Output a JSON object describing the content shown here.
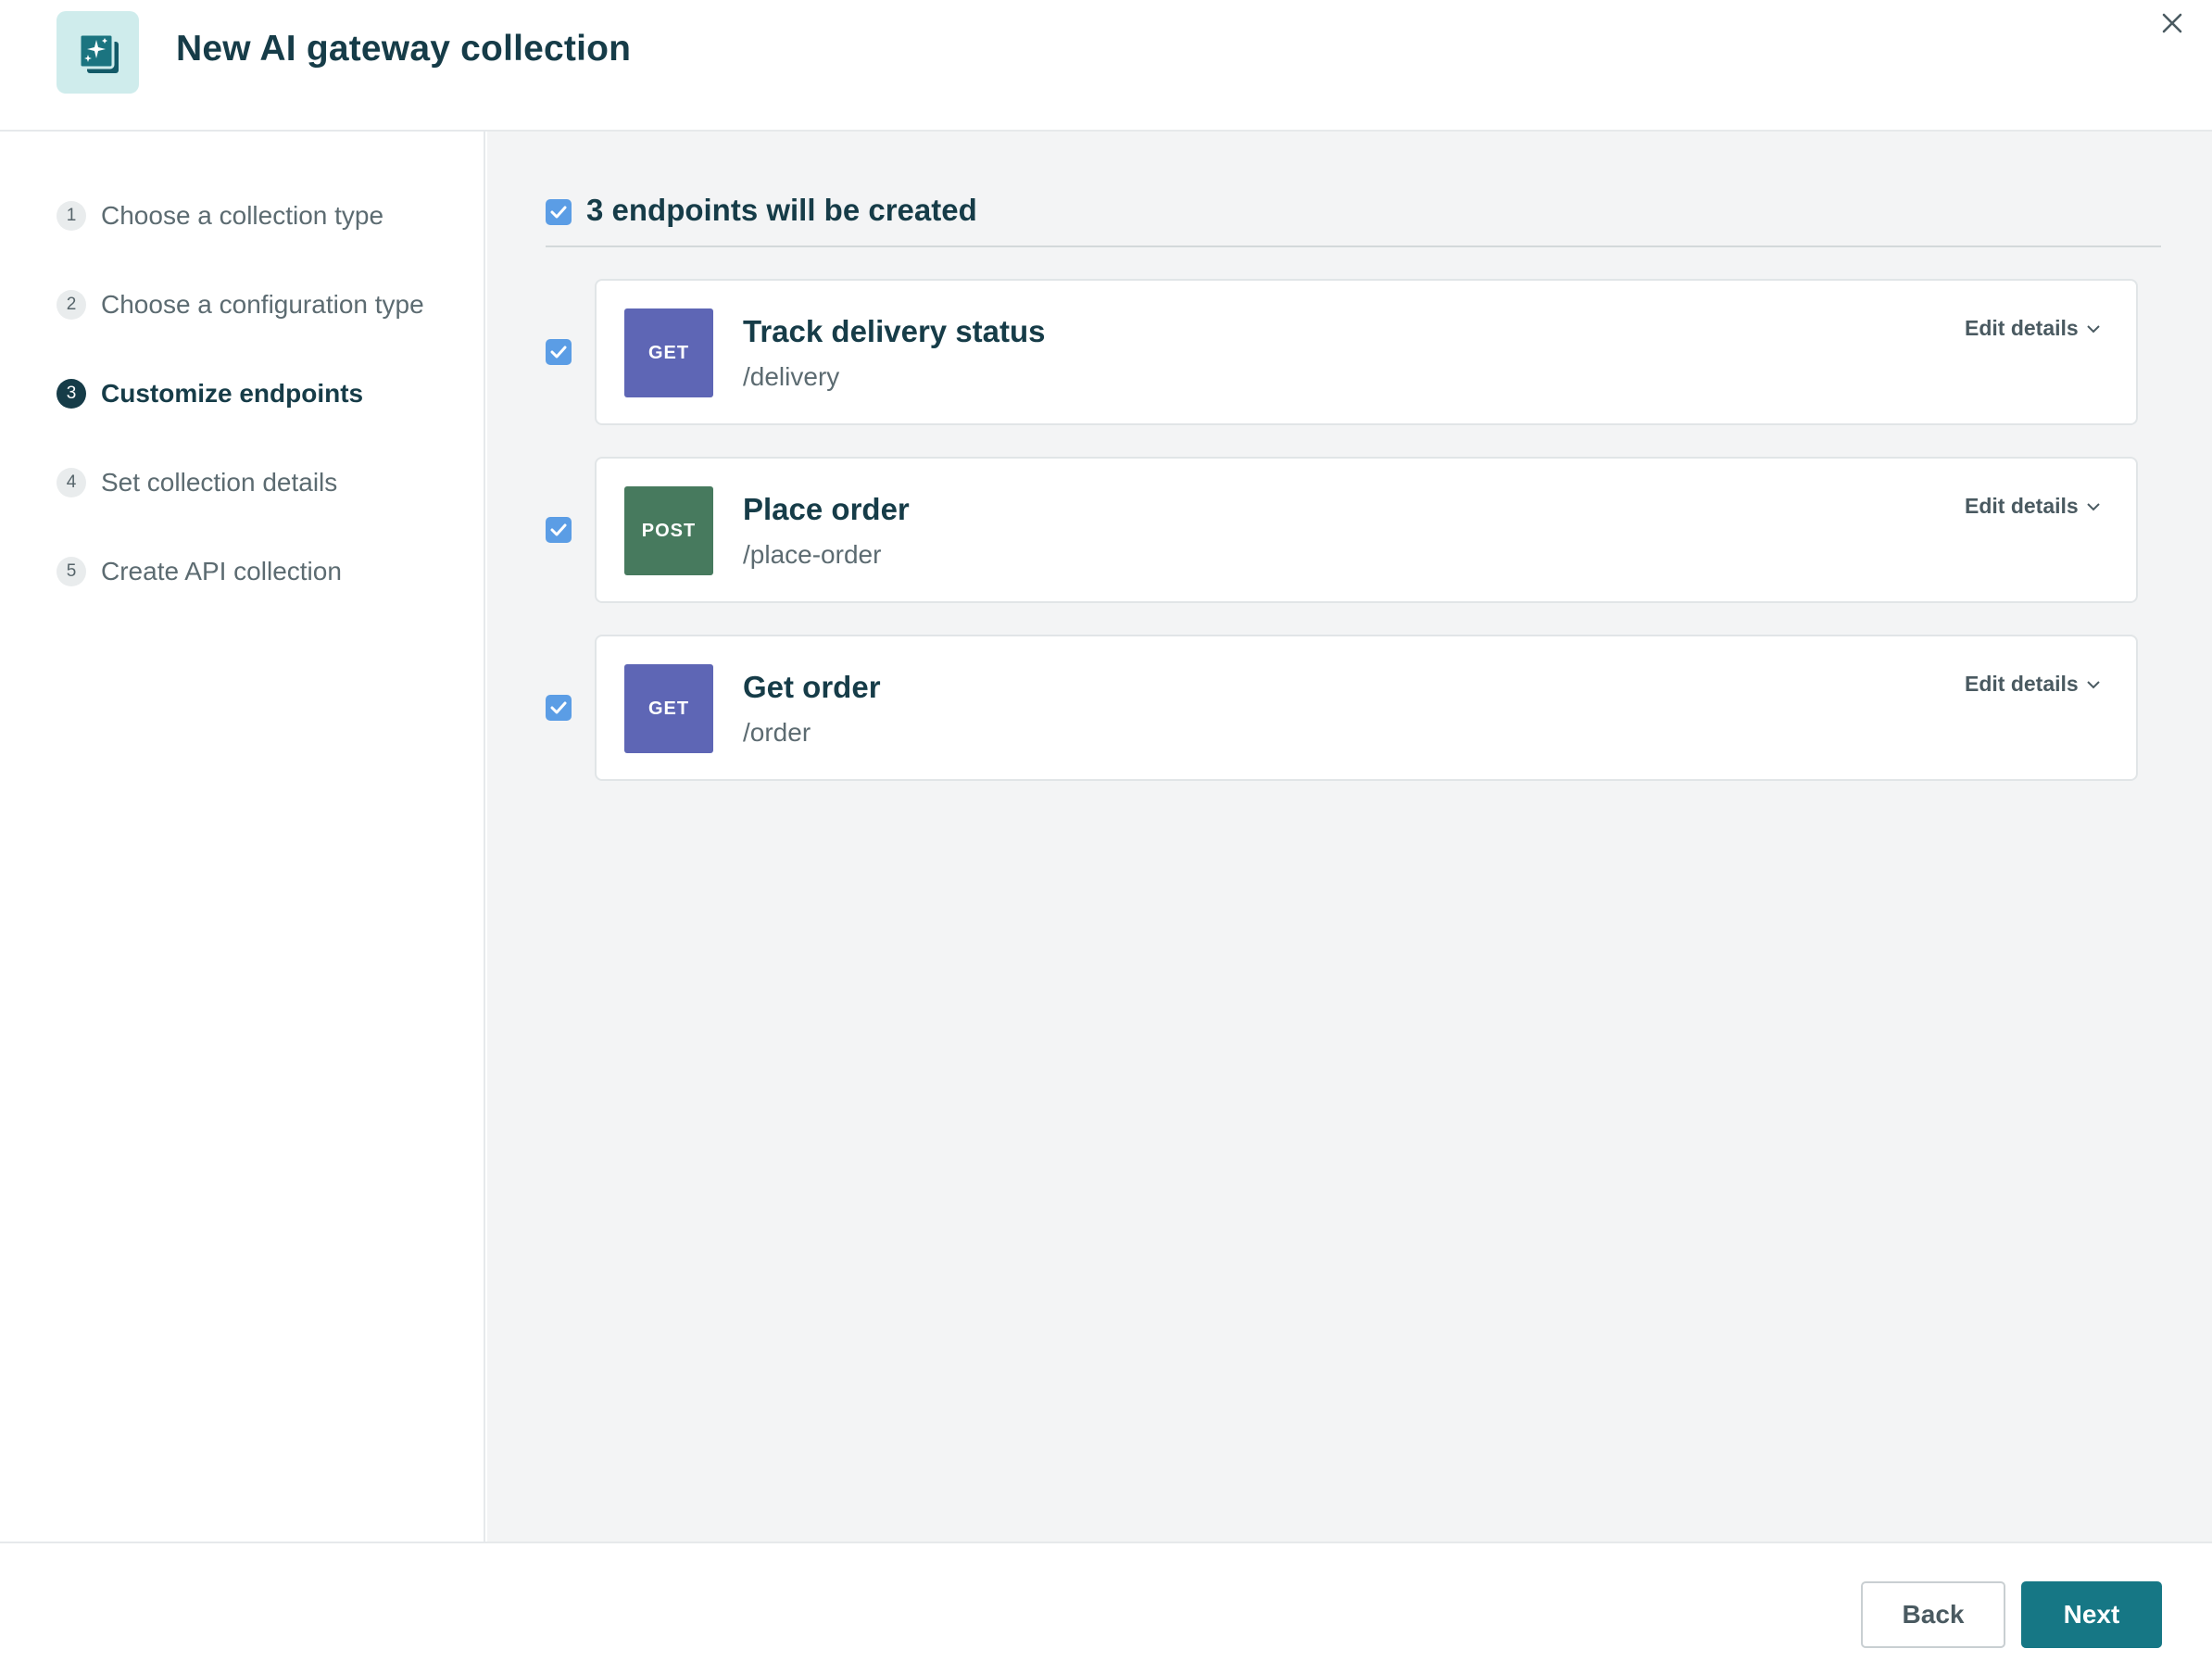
{
  "header": {
    "title": "New AI gateway collection",
    "icon": "ai-sparkle-collection-icon",
    "close_icon": "close-icon"
  },
  "steps": [
    {
      "number": "1",
      "label": "Choose a collection type",
      "active": false
    },
    {
      "number": "2",
      "label": "Choose a configuration type",
      "active": false
    },
    {
      "number": "3",
      "label": "Customize endpoints",
      "active": true
    },
    {
      "number": "4",
      "label": "Set collection details",
      "active": false
    },
    {
      "number": "5",
      "label": "Create API collection",
      "active": false
    }
  ],
  "select_all": {
    "label": "3 endpoints will be created",
    "checked": true
  },
  "endpoints": [
    {
      "method": "GET",
      "name": "Track delivery status",
      "path": "/delivery",
      "edit_label": "Edit details",
      "checked": true
    },
    {
      "method": "POST",
      "name": "Place order",
      "path": "/place-order",
      "edit_label": "Edit details",
      "checked": true
    },
    {
      "method": "GET",
      "name": "Get order",
      "path": "/order",
      "edit_label": "Edit details",
      "checked": true
    }
  ],
  "colors": {
    "get": "#5e66b5",
    "post": "#477a5e",
    "accent": "#167785",
    "checkbox": "#5b9de5"
  },
  "footer": {
    "back_label": "Back",
    "next_label": "Next"
  }
}
